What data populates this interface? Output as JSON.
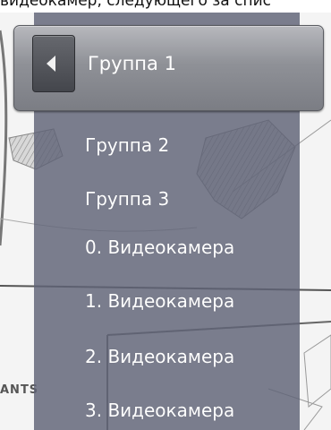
{
  "caption": "видеокамер, следующего за спис",
  "map": {
    "label": "ANTS"
  },
  "menu": {
    "header": {
      "back_icon": "left-arrow-icon",
      "title": "Группа 1"
    },
    "items": [
      {
        "label": "Группа 2"
      },
      {
        "label": "Группа 3"
      },
      {
        "label": "0. Видеокамера"
      },
      {
        "label": "1. Видеокамера"
      },
      {
        "label": "2. Видеокамера"
      },
      {
        "label": "3. Видеокамера"
      }
    ]
  },
  "colors": {
    "menu_background": "#5f6376",
    "header_background": "#8f9197",
    "text": "#ffffff"
  }
}
